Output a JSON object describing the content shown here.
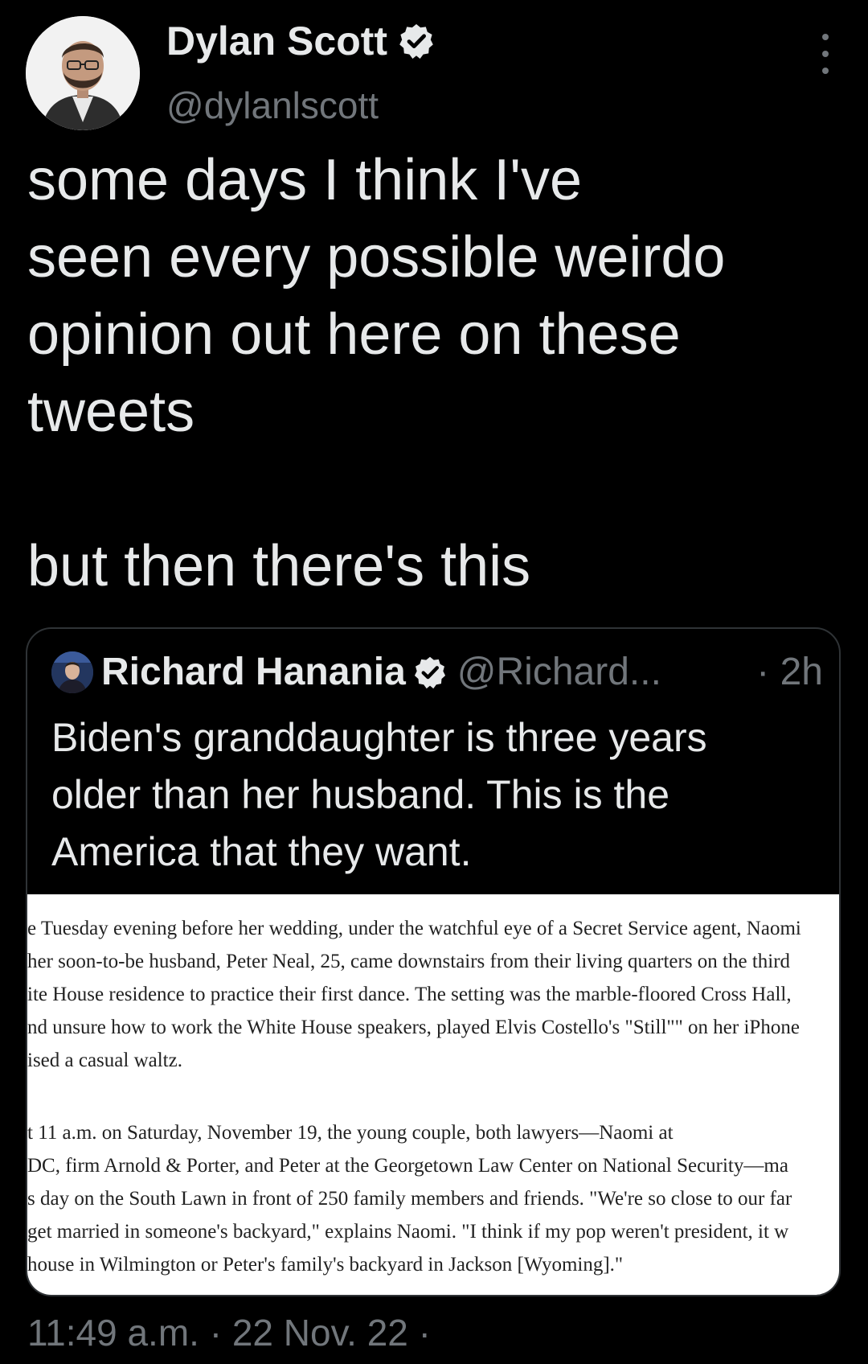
{
  "tweet": {
    "author": {
      "name": "Dylan Scott",
      "handle": "@dylanlscott",
      "verified": true
    },
    "text_lines": [
      "some days I think I've",
      "seen every possible weirdo",
      "opinion out here on these",
      "tweets",
      "but then there's this"
    ],
    "timestamp": "11:49 a.m. · 22 Nov. 22 ·"
  },
  "quoted_tweet": {
    "author": {
      "name": "Richard Hanania",
      "handle": "@Richard...",
      "verified": true
    },
    "time": "· 2h",
    "text_lines": [
      "Biden's granddaughter is three years",
      "older than her husband. This is the",
      "America that they want."
    ],
    "image_text": {
      "paragraph1": [
        "e Tuesday evening before her wedding, under the watchful eye of a Secret Service agent, Naomi",
        " her soon-to-be husband, Peter Neal, 25, came downstairs from their living quarters on the third",
        "ite House residence to practice their first dance. The setting was the marble-floored Cross Hall,",
        "nd unsure how to work the White House speakers, played Elvis Costello's \"Still\"\" on her iPhone",
        "ised a casual waltz."
      ],
      "paragraph2": [
        "t 11 a.m. on Saturday, November 19, the young couple, both lawyers—Naomi at",
        "DC, firm Arnold & Porter, and Peter at the Georgetown Law Center on National Security—ma",
        "s day on the South Lawn in front of 250 family members and friends. \"We're so close to our far",
        " get married in someone's backyard,\" explains Naomi. \"I think if my pop weren't president, it w",
        " house in Wilmington or Peter's family's backyard in Jackson [Wyoming].\""
      ]
    }
  },
  "colors": {
    "background": "#000000",
    "primary_text": "#e7e9ea",
    "secondary_text": "#71767b",
    "border": "#2f3336",
    "verified_badge": "#e7e9ea"
  },
  "icons": {
    "verified": "verified-badge-icon",
    "more": "more-vertical-icon"
  }
}
